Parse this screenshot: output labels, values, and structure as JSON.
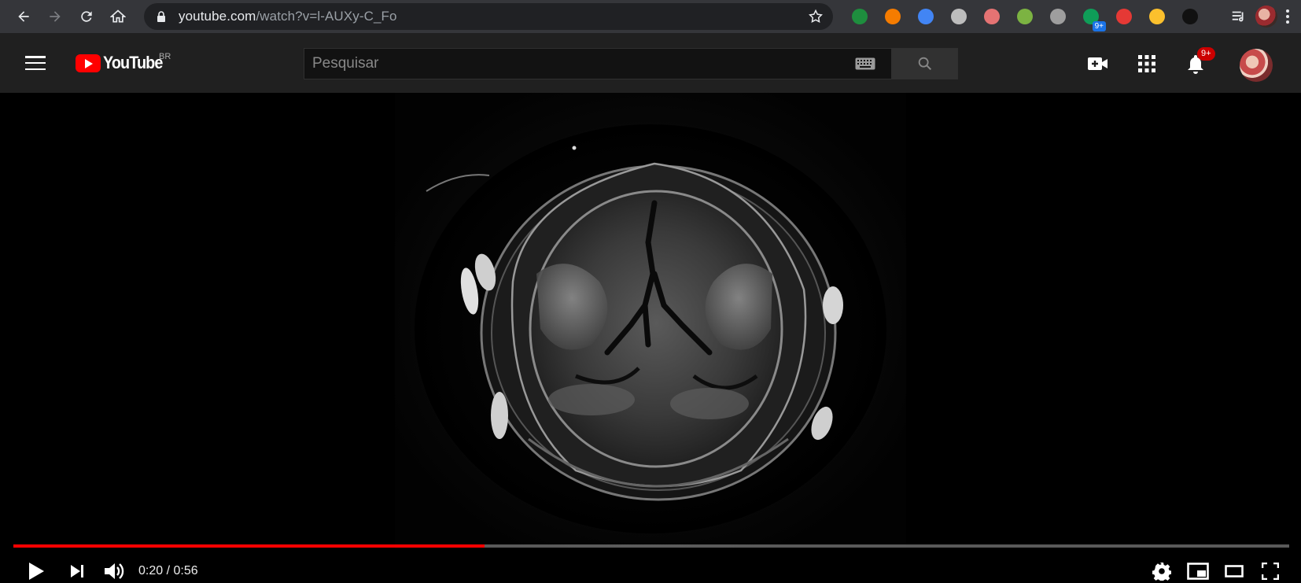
{
  "browser": {
    "url_host": "youtube.com",
    "url_path": "/watch?v=l-AUXy-C_Fo",
    "extensions": [
      {
        "name": "download-arrow-icon",
        "color": "#1e8e3e"
      },
      {
        "name": "fire-icon",
        "color": "#f57c00"
      },
      {
        "name": "google-translate-icon",
        "color": "#4285f4"
      },
      {
        "name": "bulb-icon",
        "color": "#bdbdbd"
      },
      {
        "name": "eyes-icon",
        "color": "#e57373"
      },
      {
        "name": "green-download-icon",
        "color": "#7cb342"
      },
      {
        "name": "m-icon",
        "color": "#9e9e9e"
      },
      {
        "name": "chat-icon",
        "color": "#0f9d58",
        "badge": "9+"
      },
      {
        "name": "infinity-icon",
        "color": "#e53935"
      },
      {
        "name": "balls-icon",
        "color": "#fbc02d"
      },
      {
        "name": "gnome-icon",
        "color": "#111111"
      }
    ]
  },
  "youtube": {
    "logo_text": "YouTube",
    "country_code": "BR",
    "search_placeholder": "Pesquisar",
    "notifications_count": "9+"
  },
  "player": {
    "current_time": "0:20",
    "separator": " / ",
    "duration": "0:56",
    "progress_fraction": 0.369,
    "progress_color": "#ff0000"
  }
}
